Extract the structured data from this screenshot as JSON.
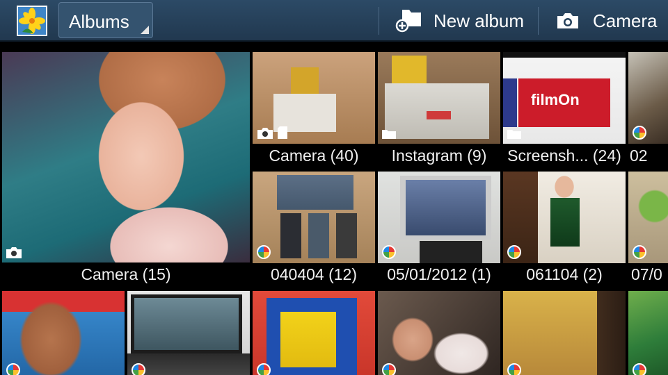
{
  "action_bar": {
    "spinner_label": "Albums",
    "new_album_label": "New album",
    "camera_label": "Camera",
    "background": "#25405a"
  },
  "albums": [
    {
      "caption": "Camera (15)",
      "source_icon": "camera-icon"
    },
    {
      "caption": "Camera (40)",
      "source_icon": "camera-icon"
    },
    {
      "caption": "Instagram (9)",
      "source_icon": "folder-icon"
    },
    {
      "caption": "Screensh... (24)",
      "source_icon": "folder-icon"
    },
    {
      "caption": "02",
      "source_icon": "picasa-icon"
    },
    {
      "caption": "040404 (12)",
      "source_icon": "picasa-icon"
    },
    {
      "caption": "05/01/2012 (1)",
      "source_icon": "picasa-icon"
    },
    {
      "caption": "061104 (2)",
      "source_icon": "picasa-icon"
    },
    {
      "caption": "07/0",
      "source_icon": "picasa-icon"
    }
  ]
}
